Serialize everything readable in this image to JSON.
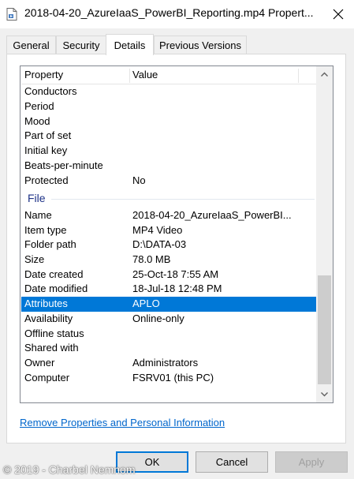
{
  "window": {
    "title": "2018-04-20_AzureIaaS_PowerBI_Reporting.mp4 Propert...",
    "icon": "document-icon",
    "close_glyph": "✕"
  },
  "tabs": [
    {
      "label": "General",
      "active": false
    },
    {
      "label": "Security",
      "active": false
    },
    {
      "label": "Details",
      "active": true
    },
    {
      "label": "Previous Versions",
      "active": false
    }
  ],
  "list": {
    "columns": {
      "property": "Property",
      "value": "Value"
    },
    "rows_top": [
      {
        "property": "Conductors",
        "value": ""
      },
      {
        "property": "Period",
        "value": ""
      },
      {
        "property": "Mood",
        "value": ""
      },
      {
        "property": "Part of set",
        "value": ""
      },
      {
        "property": "Initial key",
        "value": ""
      },
      {
        "property": "Beats-per-minute",
        "value": ""
      },
      {
        "property": "Protected",
        "value": "No"
      }
    ],
    "group_file": "File",
    "rows_file": [
      {
        "property": "Name",
        "value": "2018-04-20_AzureIaaS_PowerBI..."
      },
      {
        "property": "Item type",
        "value": "MP4 Video"
      },
      {
        "property": "Folder path",
        "value": "D:\\DATA-03"
      },
      {
        "property": "Size",
        "value": "78.0 MB"
      },
      {
        "property": "Date created",
        "value": "25-Oct-18 7:55 AM"
      },
      {
        "property": "Date modified",
        "value": "18-Jul-18 12:48 PM"
      },
      {
        "property": "Attributes",
        "value": "APLO"
      },
      {
        "property": "Availability",
        "value": "Online-only"
      },
      {
        "property": "Offline status",
        "value": ""
      },
      {
        "property": "Shared with",
        "value": ""
      },
      {
        "property": "Owner",
        "value": "Administrators"
      },
      {
        "property": "Computer",
        "value": "FSRV01 (this PC)"
      }
    ],
    "selected_row": "Attributes",
    "selection_color": "#0078d7"
  },
  "link": {
    "label": "Remove Properties and Personal Information"
  },
  "buttons": {
    "ok": "OK",
    "cancel": "Cancel",
    "apply": "Apply"
  },
  "watermark": "© 2019 - Charbel Nemnom"
}
